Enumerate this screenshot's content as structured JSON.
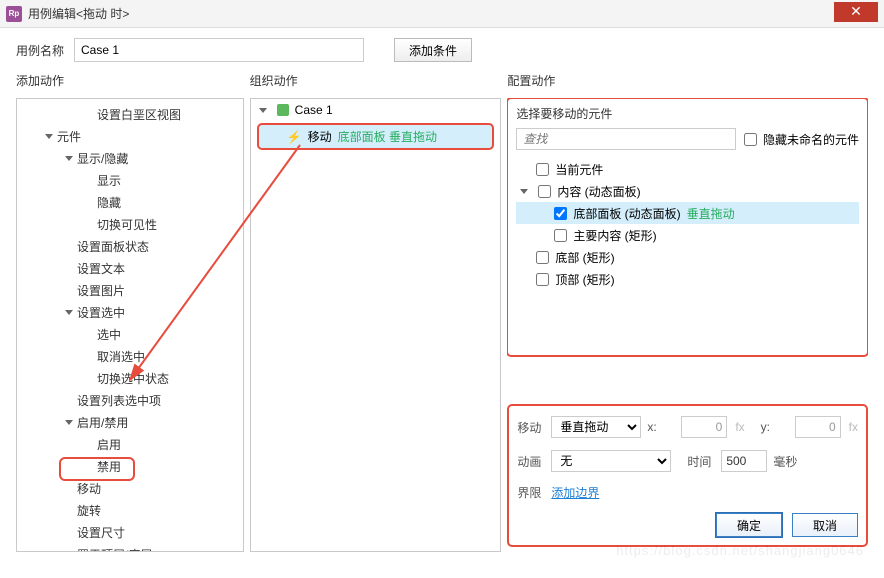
{
  "window": {
    "title": "用例编辑<拖动 时>",
    "app_icon_text": "Rp"
  },
  "toolbar": {
    "case_name_label": "用例名称",
    "case_name_value": "Case 1",
    "add_condition": "添加条件"
  },
  "columns": {
    "add_actions": "添加动作",
    "organize": "组织动作",
    "configure": "配置动作"
  },
  "action_tree": [
    {
      "label": "设置白垩区视图",
      "level": 2,
      "caret": false
    },
    {
      "label": "元件",
      "level": 0,
      "caret": true
    },
    {
      "label": "显示/隐藏",
      "level": 1,
      "caret": true
    },
    {
      "label": "显示",
      "level": 2,
      "caret": false
    },
    {
      "label": "隐藏",
      "level": 2,
      "caret": false
    },
    {
      "label": "切换可见性",
      "level": 2,
      "caret": false
    },
    {
      "label": "设置面板状态",
      "level": 1,
      "caret": false
    },
    {
      "label": "设置文本",
      "level": 1,
      "caret": false
    },
    {
      "label": "设置图片",
      "level": 1,
      "caret": false
    },
    {
      "label": "设置选中",
      "level": 1,
      "caret": true
    },
    {
      "label": "选中",
      "level": 2,
      "caret": false
    },
    {
      "label": "取消选中",
      "level": 2,
      "caret": false
    },
    {
      "label": "切换选中状态",
      "level": 2,
      "caret": false
    },
    {
      "label": "设置列表选中项",
      "level": 1,
      "caret": false
    },
    {
      "label": "启用/禁用",
      "level": 1,
      "caret": true
    },
    {
      "label": "启用",
      "level": 2,
      "caret": false
    },
    {
      "label": "禁用",
      "level": 2,
      "caret": false
    },
    {
      "label": "移动",
      "level": 1,
      "caret": false,
      "highlighted": true
    },
    {
      "label": "旋转",
      "level": 1,
      "caret": false
    },
    {
      "label": "设置尺寸",
      "level": 1,
      "caret": false
    },
    {
      "label": "置于顶层/底层",
      "level": 1,
      "caret": true
    }
  ],
  "organize": {
    "case_label": "Case 1",
    "action_label": "移动",
    "action_target": "底部面板 垂直拖动"
  },
  "configure": {
    "select_widget_title": "选择要移动的元件",
    "search_placeholder": "查找",
    "hide_unnamed": "隐藏未命名的元件",
    "widgets": [
      {
        "label": "当前元件",
        "level": 0,
        "checked": false,
        "caret": false
      },
      {
        "label": "内容 (动态面板)",
        "level": 0,
        "checked": false,
        "caret": true
      },
      {
        "label": "底部面板 (动态面板) ",
        "level": 1,
        "checked": true,
        "suffix": "垂直拖动",
        "selected": true
      },
      {
        "label": "主要内容 (矩形)",
        "level": 1,
        "checked": false
      },
      {
        "label": "底部 (矩形)",
        "level": 0,
        "checked": false
      },
      {
        "label": "顶部 (矩形)",
        "level": 0,
        "checked": false
      }
    ],
    "move_label": "移动",
    "move_type": "垂直拖动",
    "x_label": "x:",
    "x_value": "0",
    "y_label": "y:",
    "y_value": "0",
    "fx": "fx",
    "anim_label": "动画",
    "anim_type": "无",
    "time_label": "时间",
    "time_value": "500",
    "ms": "毫秒",
    "bounds_label": "界限",
    "bounds_link": "添加边界",
    "ok": "确定",
    "cancel": "取消"
  },
  "watermark": "https://blog.csdn.net/shangjiang0646"
}
